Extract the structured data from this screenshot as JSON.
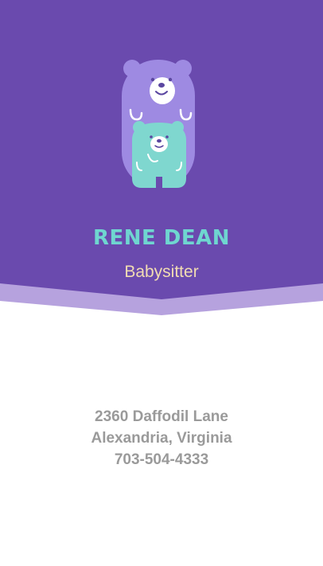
{
  "card": {
    "name": "RENE DEAN",
    "role": "Babysitter",
    "address_line1": "2360 Daffodil Lane",
    "address_line2": "Alexandria, Virginia",
    "phone": "703-504-4333"
  },
  "colors": {
    "header_purple": "#6a4aae",
    "chevron_lavender": "#b6a2de",
    "bear_lavender": "#9e8ae2",
    "bear_teal": "#7fd7cf",
    "name_teal": "#6fd6d0",
    "role_cream": "#f1dcb2",
    "contact_gray": "#9a9a9a",
    "background": "#ffffff"
  },
  "icons": {
    "logo": "bear-pair-icon"
  }
}
